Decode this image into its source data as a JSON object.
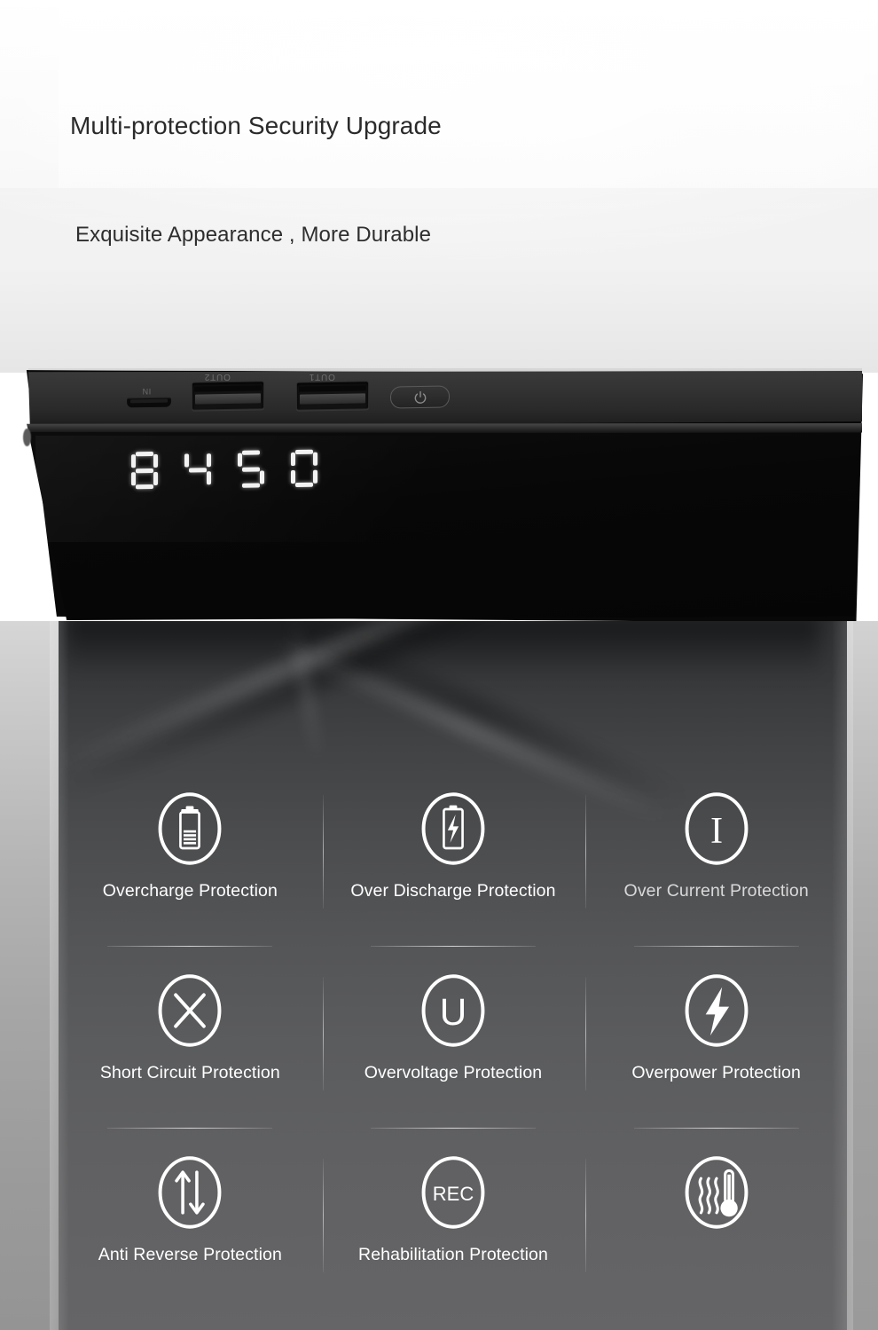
{
  "header": {
    "headline": "Multi-protection Security Upgrade",
    "subhead": "Exquisite Appearance , More Durable"
  },
  "device": {
    "port_in_label": "IN",
    "port_out2_label": "OUT2",
    "port_out1_label": "OUT1",
    "power_button_name": "power-button",
    "led_digits": [
      "8",
      "4",
      "5",
      "0"
    ]
  },
  "colors": {
    "page_background": "#ffffff",
    "top_gradient_start": "#ffffff",
    "top_gradient_end": "#e6e6e6",
    "surface_top": "#2f3133",
    "surface_bottom": "#656567",
    "surface_edge": "#b5b5b5",
    "device_body": "#080808",
    "device_top_face": "#343434",
    "icon_stroke": "#ffffff",
    "caption_text": "#ffffff",
    "caption_text_dim": "#d9d9d9",
    "heading_text": "#2a2a2a",
    "divider": "rgba(255,255,255,0.55)",
    "led_segment": "#f2f2f2"
  },
  "features": [
    {
      "id": "overcharge",
      "label": "Overcharge Protection",
      "icon": "battery-full-icon",
      "dim": false,
      "underline": true
    },
    {
      "id": "over-discharge",
      "label": "Over Discharge Protection",
      "icon": "battery-bolt-icon",
      "dim": false,
      "underline": true
    },
    {
      "id": "over-current",
      "label": "Over Current Protection",
      "icon": "letter-i-icon",
      "dim": true,
      "underline": true
    },
    {
      "id": "short-circuit",
      "label": "Short Circuit Protection",
      "icon": "cross-x-icon",
      "dim": false,
      "underline": true
    },
    {
      "id": "overvoltage",
      "label": "Overvoltage Protection",
      "icon": "letter-u-icon",
      "dim": false,
      "underline": true
    },
    {
      "id": "overpower",
      "label": "Overpower Protection",
      "icon": "lightning-bolt-icon",
      "dim": false,
      "underline": true
    },
    {
      "id": "anti-reverse",
      "label": "Anti Reverse Protection",
      "icon": "up-down-arrows-icon",
      "dim": false,
      "underline": false
    },
    {
      "id": "rehabilitation",
      "label": "Rehabilitation Protection",
      "icon": "rec-icon",
      "dim": false,
      "underline": false
    },
    {
      "id": "over-temperature",
      "label": "",
      "icon": "thermometer-heat-icon",
      "dim": false,
      "underline": false
    }
  ],
  "icon_glyphs": {
    "rec_text": "REC",
    "letter_i_text": "I",
    "letter_u_text": "U"
  }
}
